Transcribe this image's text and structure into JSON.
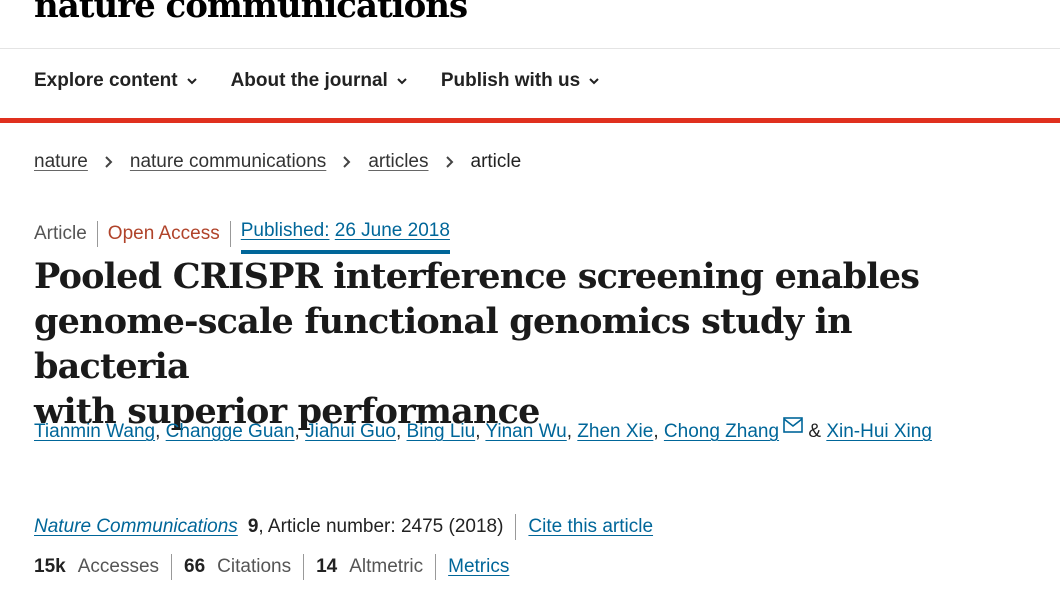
{
  "brand": {
    "name": "nature communications"
  },
  "nav": {
    "items": [
      {
        "label": "Explore content"
      },
      {
        "label": "About the journal"
      },
      {
        "label": "Publish with us"
      }
    ]
  },
  "breadcrumb": {
    "items": [
      "nature",
      "nature communications",
      "articles"
    ],
    "current": "article"
  },
  "meta": {
    "type": "Article",
    "access": "Open Access",
    "published_label": "Published:",
    "published_date": "26 June 2018"
  },
  "article": {
    "title_lines": [
      "Pooled CRISPR interference screening enables",
      "genome-scale functional genomics study in bacteria",
      "with superior performance"
    ]
  },
  "authors": {
    "list": [
      "Tianmin Wang",
      "Changge Guan",
      "Jiahui Guo",
      "Bing Liu",
      "Yinan Wu",
      "Zhen Xie",
      "Chong Zhang"
    ],
    "last_connector": "&",
    "last": "Xin-Hui Xing",
    "corresponding_icon": "mail-icon"
  },
  "journal": {
    "name": "Nature Communications",
    "volume": "9",
    "article_number": ", Article number: 2475 (2018)",
    "cite_label": "Cite this article"
  },
  "metrics": {
    "accesses_value": "15k",
    "accesses_label": "Accesses",
    "citations_value": "66",
    "citations_label": "Citations",
    "altmetric_value": "14",
    "altmetric_label": "Altmetric",
    "metrics_link": "Metrics"
  },
  "colors": {
    "accent_red": "#e0301e",
    "link_blue": "#006699",
    "open_access": "#b0432a"
  }
}
